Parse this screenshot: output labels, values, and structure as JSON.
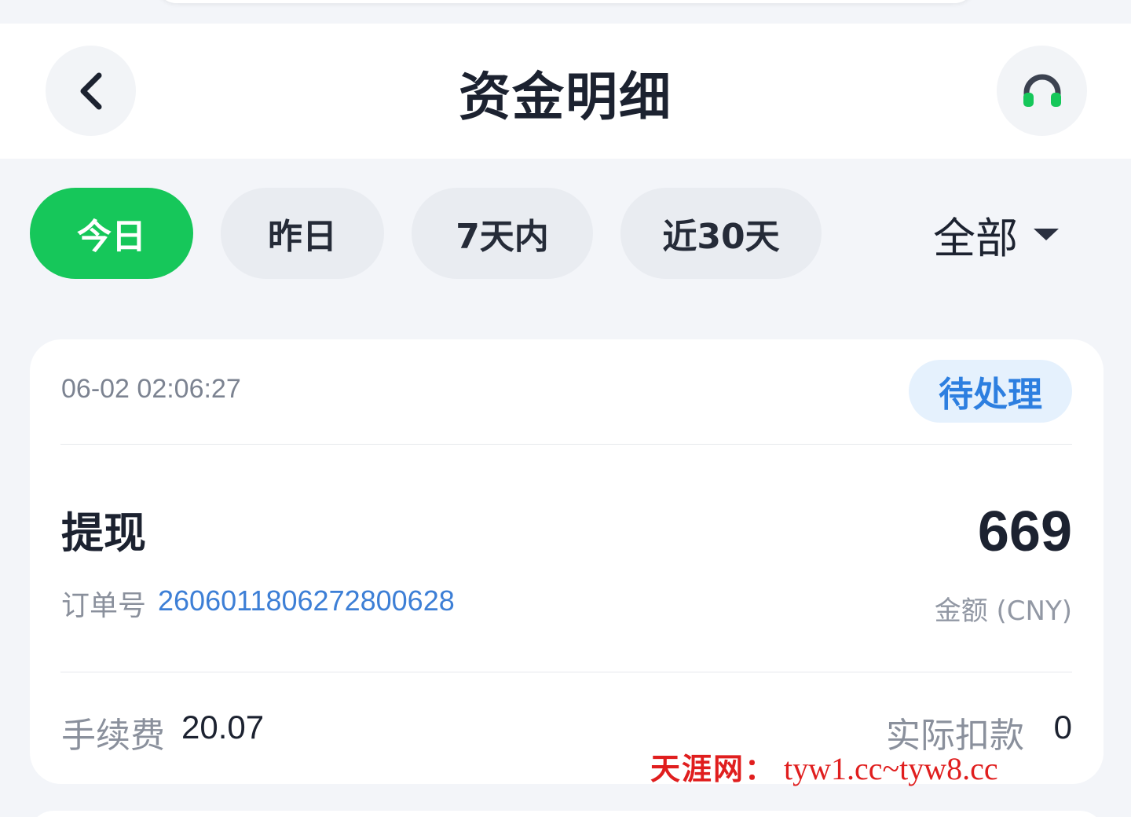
{
  "header": {
    "title": "资金明细",
    "back_icon": "chevron-left-icon",
    "service_icon": "headset-icon"
  },
  "filters": {
    "tabs": [
      {
        "label": "今日",
        "active": true
      },
      {
        "label": "昨日",
        "active": false
      },
      {
        "label": "7天内",
        "active": false
      },
      {
        "label": "近30天",
        "active": false
      }
    ],
    "type_dropdown": "全部"
  },
  "records": [
    {
      "time": "06-02 02:06:27",
      "status": "待处理",
      "type": "提现",
      "order_label": "订单号",
      "order_no": "2606011806272800628",
      "amount": "669",
      "amount_label": "金额 (CNY)",
      "fee_label": "手续费",
      "fee": "20.07",
      "actual_label": "实际扣款",
      "actual": "0"
    }
  ],
  "watermark": {
    "name": "天涯网：",
    "url": "tyw1.cc~tyw8.cc"
  },
  "colors": {
    "accent_green": "#16c75a",
    "status_blue": "#2d7fe0",
    "watermark_red": "#e01e1e"
  }
}
